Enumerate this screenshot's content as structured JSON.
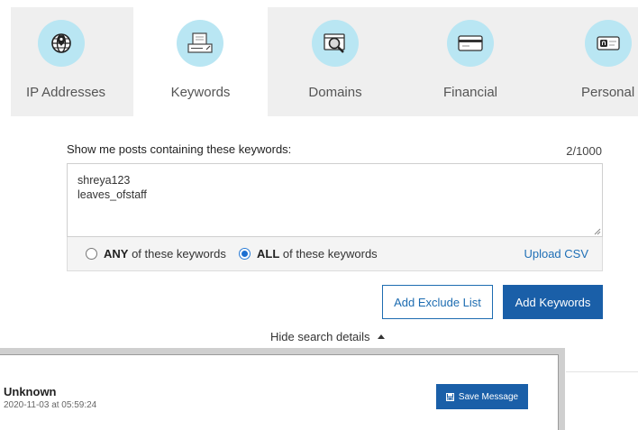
{
  "tabs": [
    {
      "label": "IP Addresses",
      "icon": "globe-pin-icon",
      "active": false
    },
    {
      "label": "Keywords",
      "icon": "keyboard-document-icon",
      "active": true
    },
    {
      "label": "Domains",
      "icon": "browser-magnifier-icon",
      "active": false
    },
    {
      "label": "Financial",
      "icon": "credit-card-icon",
      "active": false
    },
    {
      "label": "Personal",
      "icon": "id-card-icon",
      "active": false
    }
  ],
  "keywords": {
    "header": "Show me posts containing these keywords:",
    "count": "2/1000",
    "value": "shreya123\nleaves_ofstaff",
    "any_strong": "ANY",
    "any_rest": " of these keywords",
    "all_strong": "ALL",
    "all_rest": " of these keywords",
    "selected_mode": "ALL",
    "upload_label": "Upload CSV"
  },
  "actions": {
    "exclude_label": "Add Exclude List",
    "add_label": "Add Keywords",
    "hide_label": "Hide search details"
  },
  "message": {
    "author": "Unknown",
    "timestamp": "2020-11-03 at 05:59:24",
    "save_label": "Save Message"
  },
  "colors": {
    "accent": "#1a5fa8",
    "icon_bg": "#b9e6f3",
    "tab_bg": "#efefef"
  }
}
